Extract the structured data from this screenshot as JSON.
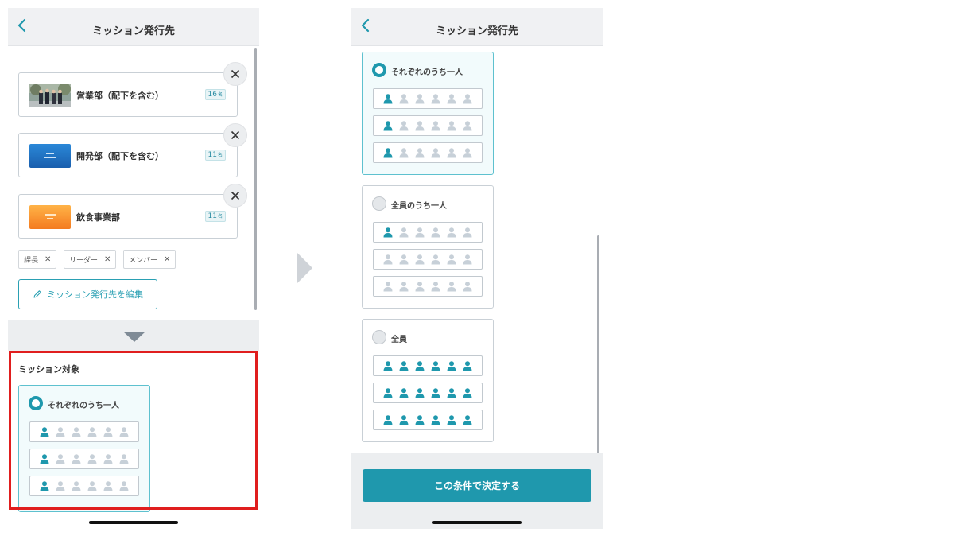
{
  "colors": {
    "accent": "#1f98ad",
    "highlight": "#e01e1e",
    "person_active": "#1f98ad",
    "person_inactive": "#c7d0d8"
  },
  "screen1": {
    "header": {
      "title": "ミッション発行先",
      "back_icon": "chevron-left-icon"
    },
    "groups": [
      {
        "name": "営業部（配下を含む）",
        "count": "16",
        "unit": "名",
        "thumb": "photo"
      },
      {
        "name": "開発部（配下を含む）",
        "count": "11",
        "unit": "名",
        "thumb": "blue"
      },
      {
        "name": "飲食事業部",
        "count": "11",
        "unit": "名",
        "thumb": "orange"
      }
    ],
    "role_tags": [
      {
        "label": "課長"
      },
      {
        "label": "リーダー"
      },
      {
        "label": "メンバー"
      }
    ],
    "edit_button": "ミッション発行先を編集",
    "section_label": "ミッション対象",
    "option": {
      "label": "それぞれのうち一人",
      "selected": true
    }
  },
  "screen2": {
    "header": {
      "title": "ミッション発行先",
      "back_icon": "chevron-left-icon"
    },
    "options": [
      {
        "label": "それぞれのうち一人",
        "selected": true,
        "rows": [
          [
            1,
            0,
            0,
            0,
            0,
            0
          ],
          [
            1,
            0,
            0,
            0,
            0,
            0
          ],
          [
            1,
            0,
            0,
            0,
            0,
            0
          ]
        ]
      },
      {
        "label": "全員のうち一人",
        "selected": false,
        "rows": [
          [
            1,
            0,
            0,
            0,
            0,
            0
          ],
          [
            0,
            0,
            0,
            0,
            0,
            0
          ],
          [
            0,
            0,
            0,
            0,
            0,
            0
          ]
        ]
      },
      {
        "label": "全員",
        "selected": false,
        "rows": [
          [
            1,
            1,
            1,
            1,
            1,
            1
          ],
          [
            1,
            1,
            1,
            1,
            1,
            1
          ],
          [
            1,
            1,
            1,
            1,
            1,
            1
          ]
        ]
      }
    ],
    "decide_button": "この条件で決定する"
  }
}
